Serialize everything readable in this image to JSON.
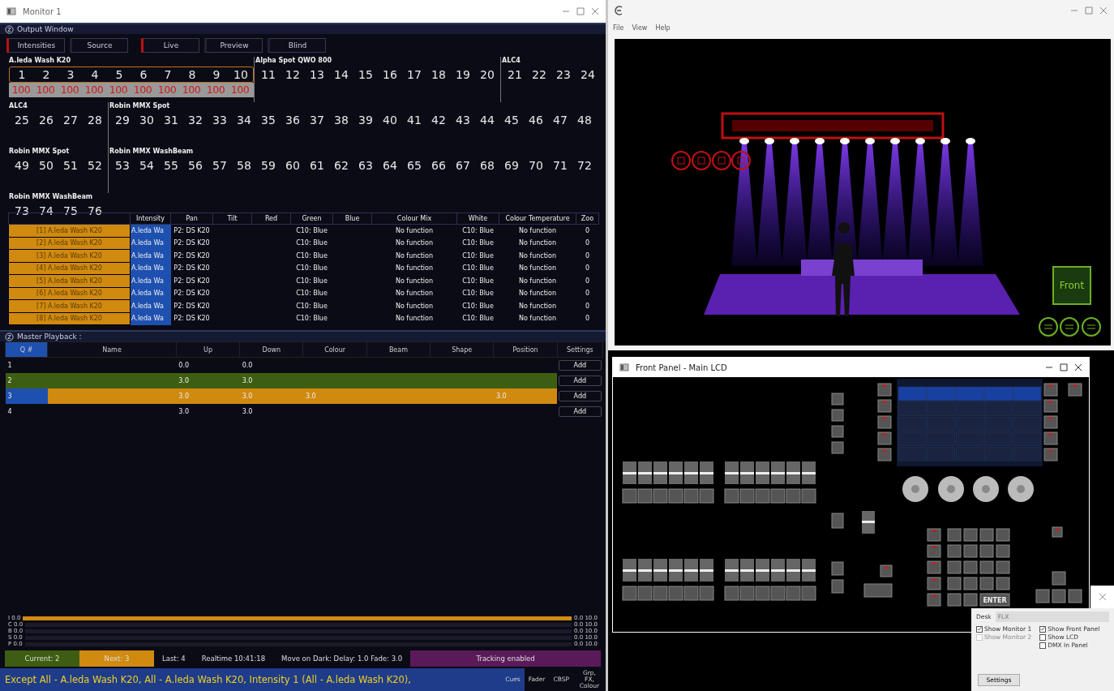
{
  "monitor": {
    "title": "Monitor 1"
  },
  "output_window": {
    "title": "Output Window",
    "tabs": [
      {
        "label": "Intensities",
        "selected": true
      },
      {
        "label": "Source",
        "selected": false
      }
    ],
    "modes": [
      {
        "label": "Live",
        "selected": true
      },
      {
        "label": "Preview",
        "selected": false
      },
      {
        "label": "Blind",
        "selected": false
      }
    ],
    "rows": [
      {
        "segments": [
          {
            "label": "A.leda Wash K20",
            "selected": true,
            "channels": [
              {
                "number": "1",
                "value": "100"
              },
              {
                "number": "2",
                "value": "100"
              },
              {
                "number": "3",
                "value": "100"
              },
              {
                "number": "4",
                "value": "100"
              },
              {
                "number": "5",
                "value": "100"
              },
              {
                "number": "6",
                "value": "100"
              },
              {
                "number": "7",
                "value": "100"
              },
              {
                "number": "8",
                "value": "100"
              },
              {
                "number": "9",
                "value": "100"
              },
              {
                "number": "10",
                "value": "100"
              }
            ]
          },
          {
            "label": "Alpha Spot QWO 800",
            "selected": false,
            "channels": [
              {
                "number": "11"
              },
              {
                "number": "12"
              },
              {
                "number": "13"
              },
              {
                "number": "14"
              },
              {
                "number": "15"
              },
              {
                "number": "16"
              },
              {
                "number": "17"
              },
              {
                "number": "18"
              },
              {
                "number": "19"
              },
              {
                "number": "20"
              }
            ]
          },
          {
            "label": "ALC4",
            "selected": false,
            "channels": [
              {
                "number": "21"
              },
              {
                "number": "22"
              },
              {
                "number": "23"
              },
              {
                "number": "24"
              }
            ]
          }
        ]
      },
      {
        "segments": [
          {
            "label": "ALC4",
            "selected": false,
            "channels": [
              {
                "number": "25"
              },
              {
                "number": "26"
              },
              {
                "number": "27"
              },
              {
                "number": "28"
              }
            ]
          },
          {
            "label": "Robin MMX Spot",
            "selected": false,
            "channels": [
              {
                "number": "29"
              },
              {
                "number": "30"
              },
              {
                "number": "31"
              },
              {
                "number": "32"
              },
              {
                "number": "33"
              },
              {
                "number": "34"
              },
              {
                "number": "35"
              },
              {
                "number": "36"
              },
              {
                "number": "37"
              },
              {
                "number": "38"
              },
              {
                "number": "39"
              },
              {
                "number": "40"
              },
              {
                "number": "41"
              },
              {
                "number": "42"
              },
              {
                "number": "43"
              },
              {
                "number": "44"
              },
              {
                "number": "45"
              },
              {
                "number": "46"
              },
              {
                "number": "47"
              },
              {
                "number": "48"
              }
            ]
          }
        ]
      },
      {
        "segments": [
          {
            "label": "Robin MMX Spot",
            "selected": false,
            "channels": [
              {
                "number": "49"
              },
              {
                "number": "50"
              },
              {
                "number": "51"
              },
              {
                "number": "52"
              }
            ]
          },
          {
            "label": "Robin MMX WashBeam",
            "selected": false,
            "channels": [
              {
                "number": "53"
              },
              {
                "number": "54"
              },
              {
                "number": "55"
              },
              {
                "number": "56"
              },
              {
                "number": "57"
              },
              {
                "number": "58"
              },
              {
                "number": "59"
              },
              {
                "number": "60"
              },
              {
                "number": "61"
              },
              {
                "number": "62"
              },
              {
                "number": "63"
              },
              {
                "number": "64"
              },
              {
                "number": "65"
              },
              {
                "number": "66"
              },
              {
                "number": "67"
              },
              {
                "number": "68"
              },
              {
                "number": "69"
              },
              {
                "number": "70"
              },
              {
                "number": "71"
              },
              {
                "number": "72"
              }
            ]
          }
        ]
      },
      {
        "segments": [
          {
            "label": "Robin MMX WashBeam",
            "selected": false,
            "channels": [
              {
                "number": "73"
              },
              {
                "number": "74"
              },
              {
                "number": "75"
              },
              {
                "number": "76"
              }
            ]
          }
        ]
      }
    ],
    "table": {
      "columns": [
        "Intensity",
        "Pan",
        "Tilt",
        "Red",
        "Green",
        "Blue",
        "Colour Mix",
        "White",
        "Colour Temperature",
        "Zoo"
      ],
      "rows": [
        {
          "name": "[1] A.leda Wash K20",
          "cells": [
            "A.leda Wa",
            "P2: DS K20",
            "",
            "",
            "C10: Blue",
            "",
            "No function",
            "C10: Blue",
            "No function",
            "0"
          ]
        },
        {
          "name": "[2] A.leda Wash K20",
          "cells": [
            "A.leda Wa",
            "P2: DS K20",
            "",
            "",
            "C10: Blue",
            "",
            "No function",
            "C10: Blue",
            "No function",
            "0"
          ]
        },
        {
          "name": "[3] A.leda Wash K20",
          "cells": [
            "A.leda Wa",
            "P2: DS K20",
            "",
            "",
            "C10: Blue",
            "",
            "No function",
            "C10: Blue",
            "No function",
            "0"
          ]
        },
        {
          "name": "[4] A.leda Wash K20",
          "cells": [
            "A.leda Wa",
            "P2: DS K20",
            "",
            "",
            "C10: Blue",
            "",
            "No function",
            "C10: Blue",
            "No function",
            "0"
          ]
        },
        {
          "name": "[5] A.leda Wash K20",
          "cells": [
            "A.leda Wa",
            "P2: DS K20",
            "",
            "",
            "C10: Blue",
            "",
            "No function",
            "C10: Blue",
            "No function",
            "0"
          ]
        },
        {
          "name": "[6] A.leda Wash K20",
          "cells": [
            "A.leda Wa",
            "P2: DS K20",
            "",
            "",
            "C10: Blue",
            "",
            "No function",
            "C10: Blue",
            "No function",
            "0"
          ]
        },
        {
          "name": "[7] A.leda Wash K20",
          "cells": [
            "A.leda Wa",
            "P2: DS K20",
            "",
            "",
            "C10: Blue",
            "",
            "No function",
            "C10: Blue",
            "No function",
            "0"
          ]
        },
        {
          "name": "[8] A.leda Wash K20",
          "cells": [
            "A.leda Wa",
            "P2: DS K20",
            "",
            "",
            "C10: Blue",
            "",
            "No function",
            "C10: Blue",
            "No function",
            "0"
          ]
        }
      ]
    }
  },
  "playback": {
    "title": "Master Playback :",
    "columns": [
      "Q #",
      "Name",
      "Up",
      "Down",
      "Colour",
      "Beam",
      "Shape",
      "Position",
      "Settings"
    ],
    "rows": [
      {
        "cells": [
          "1",
          "",
          "0.0",
          "0.0",
          "",
          "",
          "",
          ""
        ],
        "selected": false,
        "action": "Add"
      },
      {
        "cells": [
          "2",
          "",
          "3.0",
          "3.0",
          "",
          "",
          "",
          ""
        ],
        "color": "#3d5e12",
        "selected": false,
        "action": "Add"
      },
      {
        "cells": [
          "3",
          "",
          "3.0",
          "3.0",
          "3.0",
          "",
          "",
          "3.0"
        ],
        "color": "#d08a10",
        "selected": true,
        "action": "Add"
      },
      {
        "cells": [
          "4",
          "",
          "3.0",
          "3.0",
          "",
          "",
          "",
          ""
        ],
        "selected": false,
        "action": "Add"
      }
    ],
    "lanes": [
      {
        "label": "I 0.0",
        "end": "0.0 10.0",
        "level": 1
      },
      {
        "label": "C 0.0",
        "end": "0.0 10.0",
        "level": 0
      },
      {
        "label": "B 0.0",
        "end": "0.0 10.0",
        "level": 0
      },
      {
        "label": "S 0.0",
        "end": "0.0 10.0",
        "level": 0
      },
      {
        "label": "P 0.0",
        "end": "0.0 10.0",
        "level": 0
      }
    ],
    "status": [
      {
        "text": "Current: 2",
        "kind": "current"
      },
      {
        "text": "Next: 3",
        "kind": "next"
      },
      {
        "text": "Last: 4",
        "kind": "plain"
      },
      {
        "text": "Realtime 10:41:18",
        "kind": "plain"
      },
      {
        "text": "Move on Dark: Delay: 1.0  Fade: 3.0",
        "kind": "plain"
      },
      {
        "text": "Tracking enabled",
        "kind": "tracking"
      }
    ],
    "command_line": "Except All - A.leda Wash K20, All - A.leda Wash K20, Intensity 1 (All - A.leda Wash K20),",
    "view_tabs": [
      {
        "label": "Cues",
        "selected": true
      },
      {
        "label": "Fader",
        "selected": false
      },
      {
        "label": "CBSP",
        "selected": false
      },
      {
        "label": "Grp, FX, Colour",
        "selected": false
      }
    ]
  },
  "visualiser": {
    "menu": [
      "File",
      "View",
      "Help"
    ],
    "view_button": "Front"
  },
  "front_panel": {
    "title": "Front Panel - Main LCD",
    "enter_key": "ENTER"
  },
  "dialog": {
    "desk_label": "Desk",
    "desk_value": "FLX",
    "options": [
      {
        "label": "Show Monitor 1",
        "checked": true,
        "disabled": false
      },
      {
        "label": "Show Monitor 2",
        "checked": false,
        "disabled": true
      }
    ],
    "options_right": [
      {
        "label": "Show Front Panel",
        "checked": true,
        "disabled": false
      },
      {
        "label": "Show LCD",
        "checked": false,
        "disabled": false
      },
      {
        "label": "DMX In Panel",
        "checked": false,
        "disabled": false
      }
    ],
    "button": "Settings"
  }
}
